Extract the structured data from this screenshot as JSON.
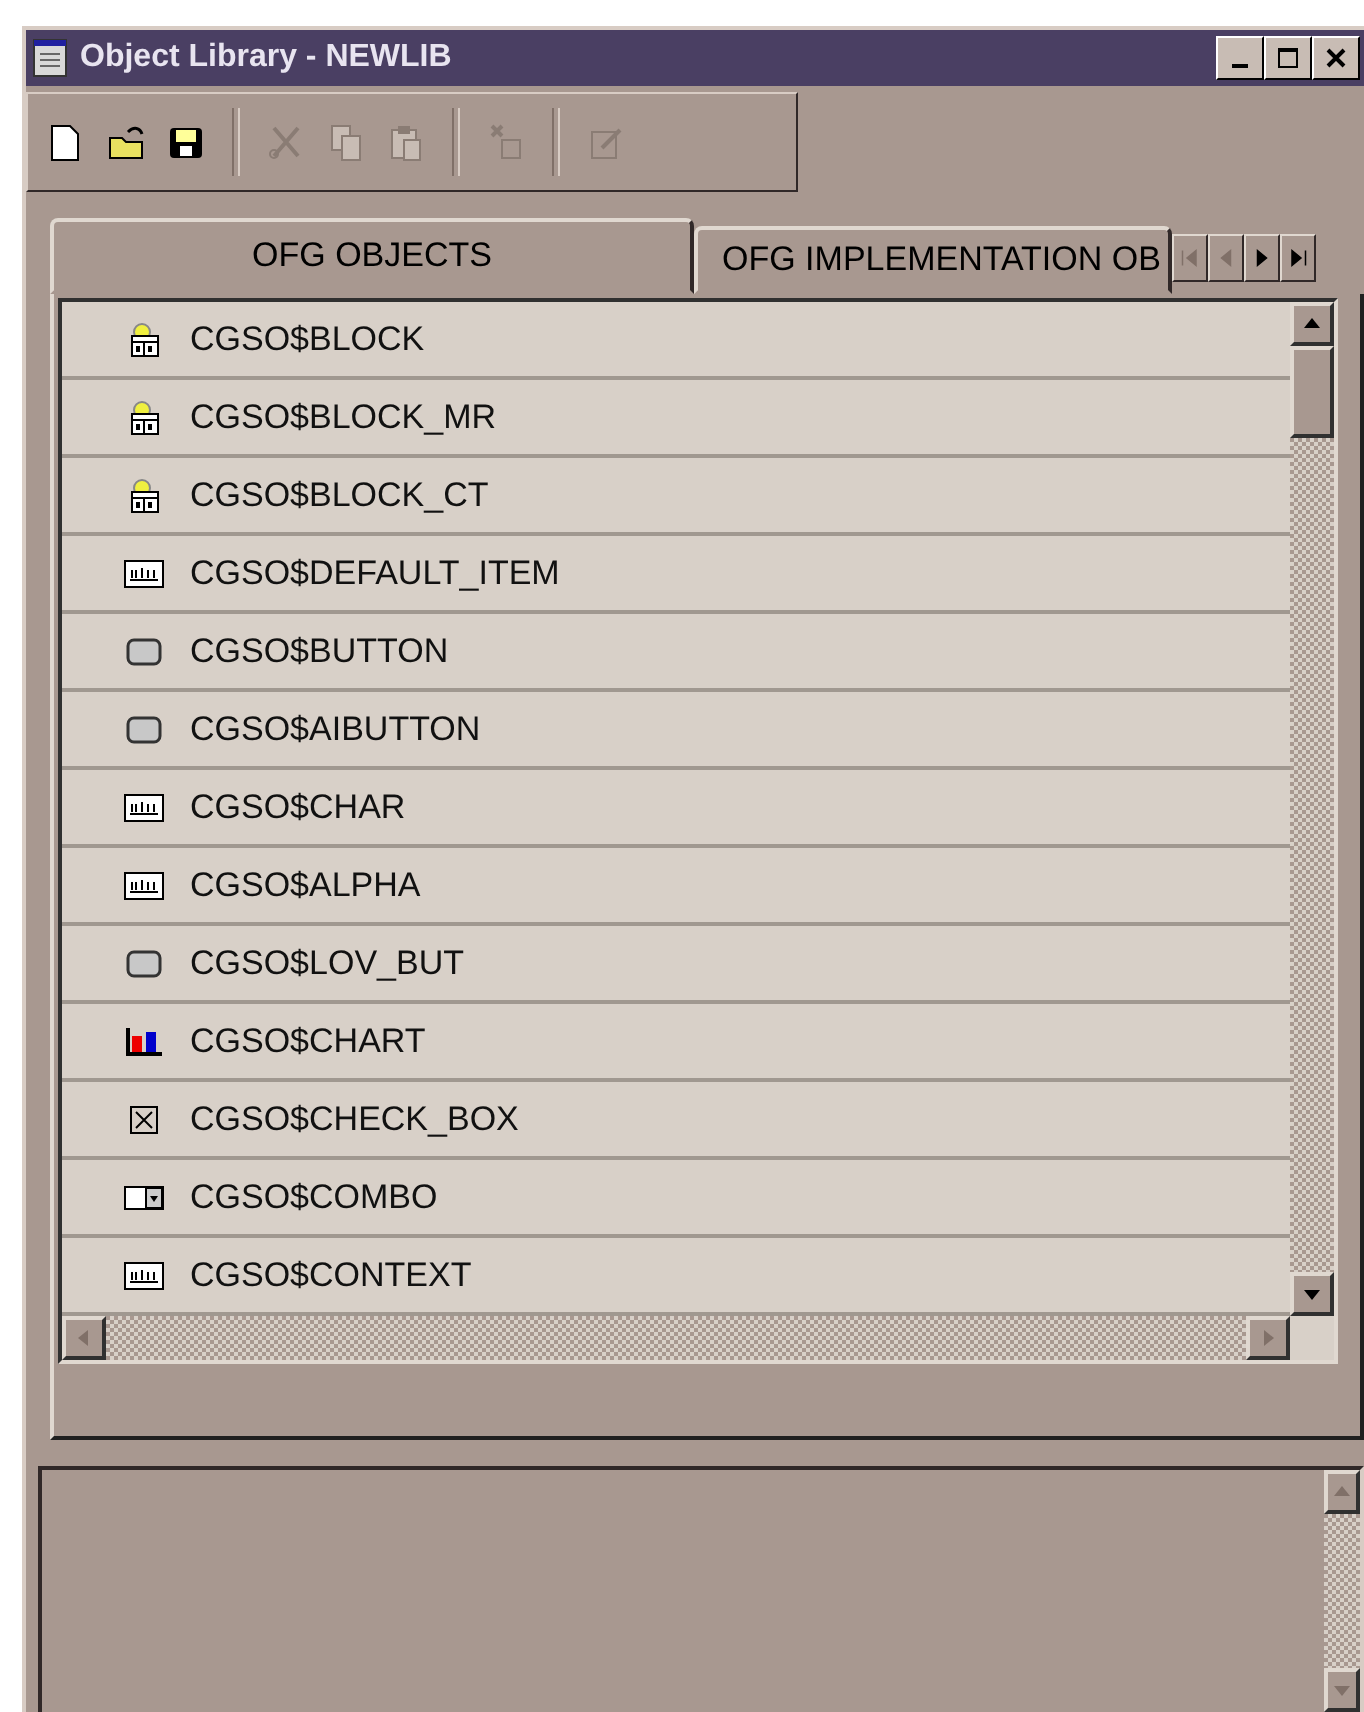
{
  "window": {
    "title": "Object Library - NEWLIB"
  },
  "toolbar": [
    {
      "kind": "new",
      "disabled": false
    },
    {
      "kind": "open",
      "disabled": false
    },
    {
      "kind": "save",
      "disabled": false
    },
    {
      "kind": "separator"
    },
    {
      "kind": "cut",
      "disabled": true
    },
    {
      "kind": "copy",
      "disabled": true
    },
    {
      "kind": "paste",
      "disabled": true
    },
    {
      "kind": "separator"
    },
    {
      "kind": "create",
      "disabled": true
    },
    {
      "kind": "separator"
    },
    {
      "kind": "properties",
      "disabled": true
    }
  ],
  "tabs": [
    {
      "label": "OFG OBJECTS",
      "selected": true
    },
    {
      "label": "OFG IMPLEMENTATION OB",
      "selected": false
    }
  ],
  "tab_nav": [
    {
      "kind": "first",
      "disabled": true
    },
    {
      "kind": "prev",
      "disabled": true
    },
    {
      "kind": "next",
      "disabled": false
    },
    {
      "kind": "last",
      "disabled": false
    }
  ],
  "objects": [
    {
      "name": "CGSO$BLOCK",
      "kind": "block"
    },
    {
      "name": "CGSO$BLOCK_MR",
      "kind": "block"
    },
    {
      "name": "CGSO$BLOCK_CT",
      "kind": "block"
    },
    {
      "name": "CGSO$DEFAULT_ITEM",
      "kind": "text"
    },
    {
      "name": "CGSO$BUTTON",
      "kind": "button"
    },
    {
      "name": "CGSO$AIBUTTON",
      "kind": "button"
    },
    {
      "name": "CGSO$CHAR",
      "kind": "text"
    },
    {
      "name": "CGSO$ALPHA",
      "kind": "text"
    },
    {
      "name": "CGSO$LOV_BUT",
      "kind": "button"
    },
    {
      "name": "CGSO$CHART",
      "kind": "chart"
    },
    {
      "name": "CGSO$CHECK_BOX",
      "kind": "checkbox"
    },
    {
      "name": "CGSO$COMBO",
      "kind": "combo"
    },
    {
      "name": "CGSO$CONTEXT",
      "kind": "text"
    }
  ]
}
